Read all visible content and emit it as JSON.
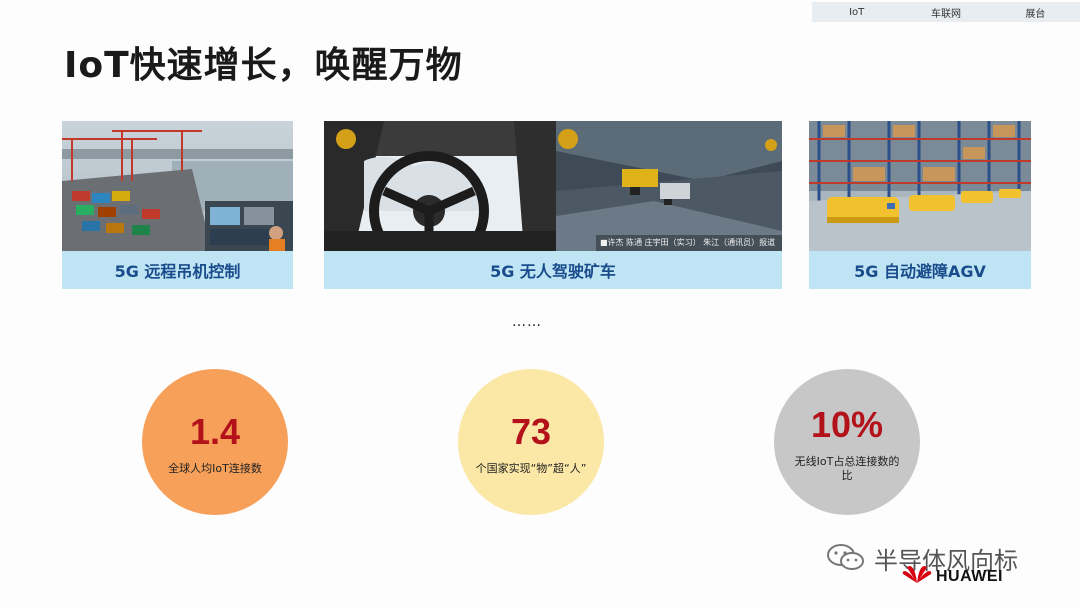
{
  "nav": {
    "items": [
      "IoT",
      "车联网",
      "展台"
    ]
  },
  "title": "IoT快速增长，唤醒万物",
  "cards": [
    {
      "caption": "5G 远程吊机控制"
    },
    {
      "caption": "5G 无人驾驶矿车",
      "photo_caption": "■许杰 陈通 庄宇田（实习） 朱江（通讯员）报道"
    },
    {
      "caption": "5G 自动避障AGV"
    }
  ],
  "ellipsis": "……",
  "stats": [
    {
      "value": "1.4",
      "label": "全球人均IoT连接数",
      "color": "#f6a05a"
    },
    {
      "value": "73",
      "label": "个国家实现“物”超“人”",
      "color": "#fbe8a6"
    },
    {
      "value": "10%",
      "label": "无线IoT占总连接数的比",
      "color": "#c7c7c7"
    }
  ],
  "watermark": "半导体风向标",
  "brand": "HUAWEI"
}
